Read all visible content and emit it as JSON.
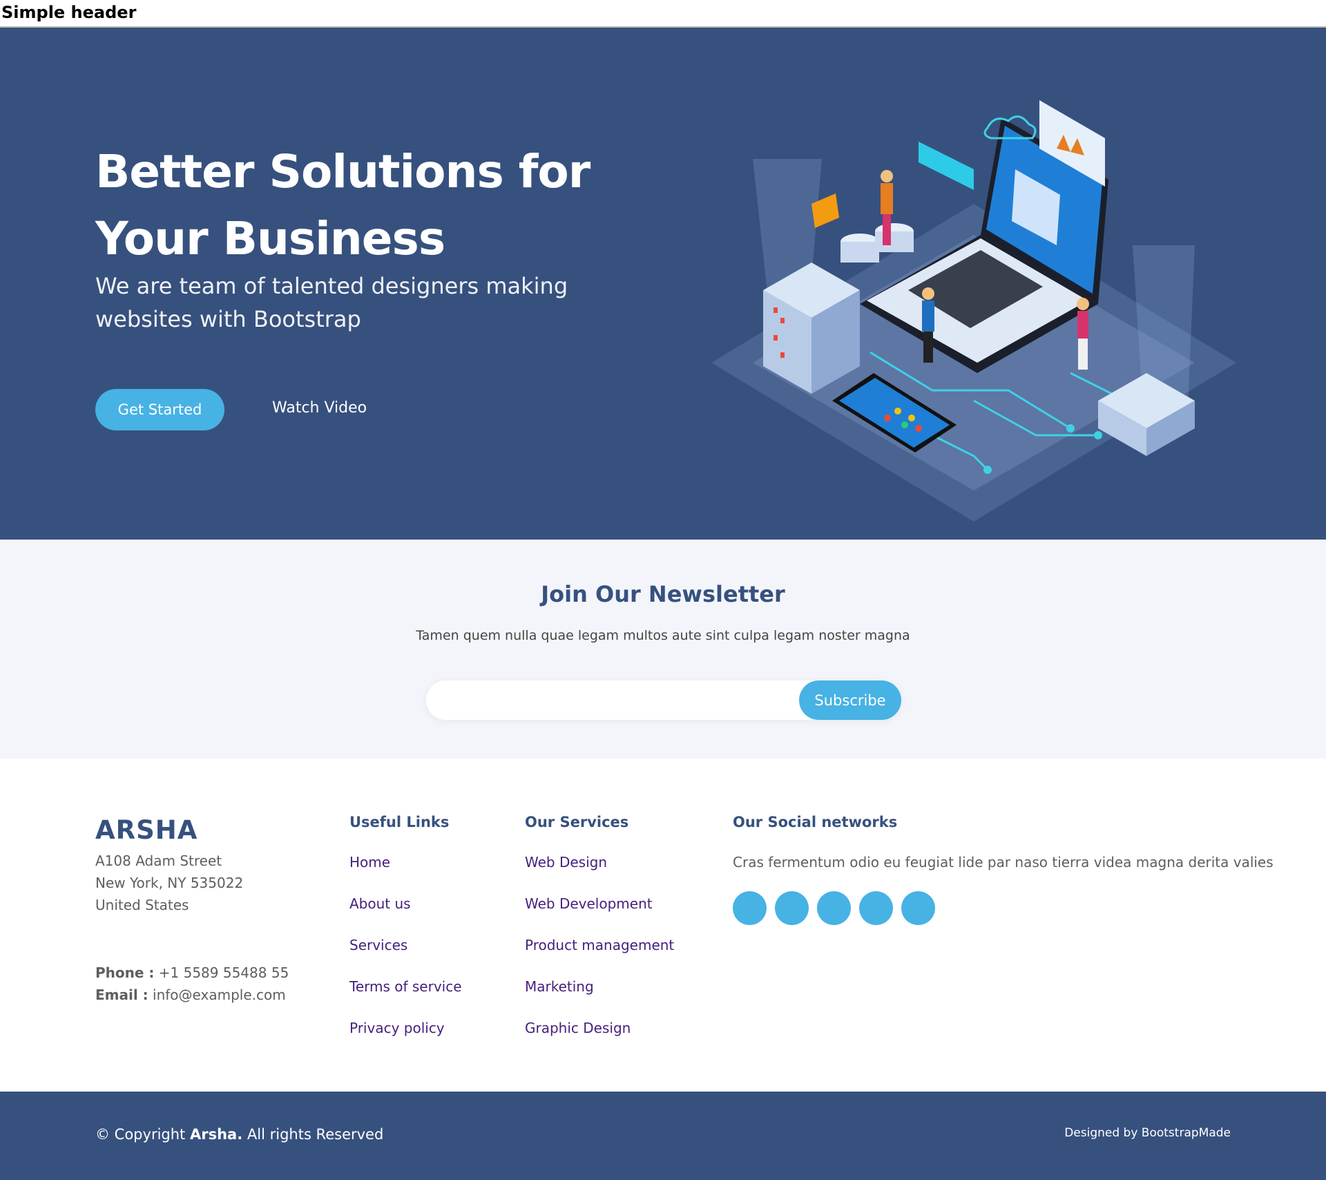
{
  "header": {
    "title": "Simple header"
  },
  "hero": {
    "title": "Better Solutions for Your Business",
    "subtitle": "We are team of talented designers making websites with Bootstrap",
    "primary_button": "Get Started",
    "secondary_button": "Watch Video"
  },
  "newsletter": {
    "title": "Join Our Newsletter",
    "text": "Tamen quem nulla quae legam multos aute sint culpa legam noster magna",
    "input_value": "",
    "button": "Subscribe"
  },
  "footer": {
    "brand": "ARSHA",
    "address_line1": "A108 Adam Street",
    "address_line2": "New York, NY 535022",
    "address_line3": "United States",
    "phone_label": "Phone :",
    "phone": "+1 5589 55488 55",
    "email_label": "Email :",
    "email": "info@example.com",
    "useful_links": {
      "title": "Useful Links",
      "items": [
        "Home",
        "About us",
        "Services",
        "Terms of service",
        "Privacy policy"
      ]
    },
    "services": {
      "title": "Our Services",
      "items": [
        "Web Design",
        "Web Development",
        "Product management",
        "Marketing",
        "Graphic Design"
      ]
    },
    "social": {
      "title": "Our Social networks",
      "text": "Cras fermentum odio eu feugiat lide par naso tierra videa magna derita valies"
    }
  },
  "bottom": {
    "copyright_prefix": "© Copyright",
    "copyright_brand": "Arsha.",
    "copyright_suffix": "All rights Reserved",
    "credit": "Designed by BootstrapMade"
  },
  "colors": {
    "primary_dark": "#37517e",
    "accent": "#47b2e4",
    "newsletter_bg": "#f3f5fa",
    "link": "#47207d"
  }
}
